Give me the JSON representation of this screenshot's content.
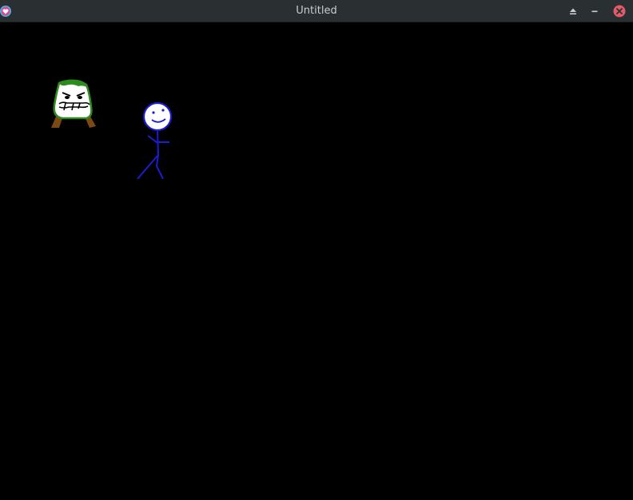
{
  "window": {
    "title": "Untitled",
    "background": "#000000",
    "titlebar_color": "#2a2f32",
    "close_color": "#e25b6a"
  },
  "titlebar": {
    "app_icon": "app-heart-icon",
    "buttons": [
      {
        "name": "keep-above-button",
        "icon": "eject-triangle-icon"
      },
      {
        "name": "minimize-button",
        "icon": "minus-icon"
      },
      {
        "name": "close-button",
        "icon": "close-icon"
      }
    ]
  },
  "scene": {
    "sprites": [
      {
        "name": "green-blob-creature",
        "colors": {
          "outline": "#2e8b1e",
          "body": "#ffffff",
          "feet": "#7a4a12"
        }
      },
      {
        "name": "blue-stick-figure",
        "colors": {
          "stroke": "#1c1cd0",
          "face": "#ffffff"
        }
      }
    ]
  }
}
